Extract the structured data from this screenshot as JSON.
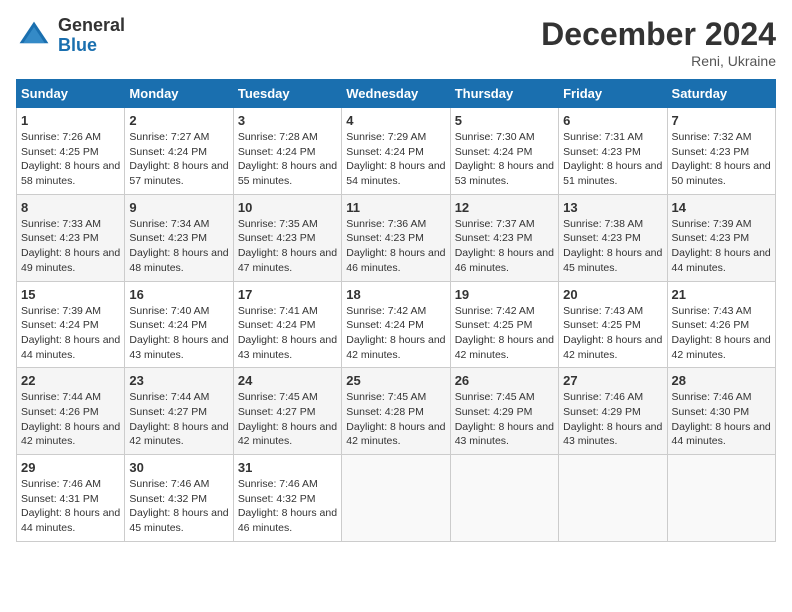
{
  "logo": {
    "general": "General",
    "blue": "Blue"
  },
  "title": "December 2024",
  "location": "Reni, Ukraine",
  "weekdays": [
    "Sunday",
    "Monday",
    "Tuesday",
    "Wednesday",
    "Thursday",
    "Friday",
    "Saturday"
  ],
  "weeks": [
    [
      {
        "day": "1",
        "sunrise": "Sunrise: 7:26 AM",
        "sunset": "Sunset: 4:25 PM",
        "daylight": "Daylight: 8 hours and 58 minutes."
      },
      {
        "day": "2",
        "sunrise": "Sunrise: 7:27 AM",
        "sunset": "Sunset: 4:24 PM",
        "daylight": "Daylight: 8 hours and 57 minutes."
      },
      {
        "day": "3",
        "sunrise": "Sunrise: 7:28 AM",
        "sunset": "Sunset: 4:24 PM",
        "daylight": "Daylight: 8 hours and 55 minutes."
      },
      {
        "day": "4",
        "sunrise": "Sunrise: 7:29 AM",
        "sunset": "Sunset: 4:24 PM",
        "daylight": "Daylight: 8 hours and 54 minutes."
      },
      {
        "day": "5",
        "sunrise": "Sunrise: 7:30 AM",
        "sunset": "Sunset: 4:24 PM",
        "daylight": "Daylight: 8 hours and 53 minutes."
      },
      {
        "day": "6",
        "sunrise": "Sunrise: 7:31 AM",
        "sunset": "Sunset: 4:23 PM",
        "daylight": "Daylight: 8 hours and 51 minutes."
      },
      {
        "day": "7",
        "sunrise": "Sunrise: 7:32 AM",
        "sunset": "Sunset: 4:23 PM",
        "daylight": "Daylight: 8 hours and 50 minutes."
      }
    ],
    [
      {
        "day": "8",
        "sunrise": "Sunrise: 7:33 AM",
        "sunset": "Sunset: 4:23 PM",
        "daylight": "Daylight: 8 hours and 49 minutes."
      },
      {
        "day": "9",
        "sunrise": "Sunrise: 7:34 AM",
        "sunset": "Sunset: 4:23 PM",
        "daylight": "Daylight: 8 hours and 48 minutes."
      },
      {
        "day": "10",
        "sunrise": "Sunrise: 7:35 AM",
        "sunset": "Sunset: 4:23 PM",
        "daylight": "Daylight: 8 hours and 47 minutes."
      },
      {
        "day": "11",
        "sunrise": "Sunrise: 7:36 AM",
        "sunset": "Sunset: 4:23 PM",
        "daylight": "Daylight: 8 hours and 46 minutes."
      },
      {
        "day": "12",
        "sunrise": "Sunrise: 7:37 AM",
        "sunset": "Sunset: 4:23 PM",
        "daylight": "Daylight: 8 hours and 46 minutes."
      },
      {
        "day": "13",
        "sunrise": "Sunrise: 7:38 AM",
        "sunset": "Sunset: 4:23 PM",
        "daylight": "Daylight: 8 hours and 45 minutes."
      },
      {
        "day": "14",
        "sunrise": "Sunrise: 7:39 AM",
        "sunset": "Sunset: 4:23 PM",
        "daylight": "Daylight: 8 hours and 44 minutes."
      }
    ],
    [
      {
        "day": "15",
        "sunrise": "Sunrise: 7:39 AM",
        "sunset": "Sunset: 4:24 PM",
        "daylight": "Daylight: 8 hours and 44 minutes."
      },
      {
        "day": "16",
        "sunrise": "Sunrise: 7:40 AM",
        "sunset": "Sunset: 4:24 PM",
        "daylight": "Daylight: 8 hours and 43 minutes."
      },
      {
        "day": "17",
        "sunrise": "Sunrise: 7:41 AM",
        "sunset": "Sunset: 4:24 PM",
        "daylight": "Daylight: 8 hours and 43 minutes."
      },
      {
        "day": "18",
        "sunrise": "Sunrise: 7:42 AM",
        "sunset": "Sunset: 4:24 PM",
        "daylight": "Daylight: 8 hours and 42 minutes."
      },
      {
        "day": "19",
        "sunrise": "Sunrise: 7:42 AM",
        "sunset": "Sunset: 4:25 PM",
        "daylight": "Daylight: 8 hours and 42 minutes."
      },
      {
        "day": "20",
        "sunrise": "Sunrise: 7:43 AM",
        "sunset": "Sunset: 4:25 PM",
        "daylight": "Daylight: 8 hours and 42 minutes."
      },
      {
        "day": "21",
        "sunrise": "Sunrise: 7:43 AM",
        "sunset": "Sunset: 4:26 PM",
        "daylight": "Daylight: 8 hours and 42 minutes."
      }
    ],
    [
      {
        "day": "22",
        "sunrise": "Sunrise: 7:44 AM",
        "sunset": "Sunset: 4:26 PM",
        "daylight": "Daylight: 8 hours and 42 minutes."
      },
      {
        "day": "23",
        "sunrise": "Sunrise: 7:44 AM",
        "sunset": "Sunset: 4:27 PM",
        "daylight": "Daylight: 8 hours and 42 minutes."
      },
      {
        "day": "24",
        "sunrise": "Sunrise: 7:45 AM",
        "sunset": "Sunset: 4:27 PM",
        "daylight": "Daylight: 8 hours and 42 minutes."
      },
      {
        "day": "25",
        "sunrise": "Sunrise: 7:45 AM",
        "sunset": "Sunset: 4:28 PM",
        "daylight": "Daylight: 8 hours and 42 minutes."
      },
      {
        "day": "26",
        "sunrise": "Sunrise: 7:45 AM",
        "sunset": "Sunset: 4:29 PM",
        "daylight": "Daylight: 8 hours and 43 minutes."
      },
      {
        "day": "27",
        "sunrise": "Sunrise: 7:46 AM",
        "sunset": "Sunset: 4:29 PM",
        "daylight": "Daylight: 8 hours and 43 minutes."
      },
      {
        "day": "28",
        "sunrise": "Sunrise: 7:46 AM",
        "sunset": "Sunset: 4:30 PM",
        "daylight": "Daylight: 8 hours and 44 minutes."
      }
    ],
    [
      {
        "day": "29",
        "sunrise": "Sunrise: 7:46 AM",
        "sunset": "Sunset: 4:31 PM",
        "daylight": "Daylight: 8 hours and 44 minutes."
      },
      {
        "day": "30",
        "sunrise": "Sunrise: 7:46 AM",
        "sunset": "Sunset: 4:32 PM",
        "daylight": "Daylight: 8 hours and 45 minutes."
      },
      {
        "day": "31",
        "sunrise": "Sunrise: 7:46 AM",
        "sunset": "Sunset: 4:32 PM",
        "daylight": "Daylight: 8 hours and 46 minutes."
      },
      null,
      null,
      null,
      null
    ]
  ]
}
